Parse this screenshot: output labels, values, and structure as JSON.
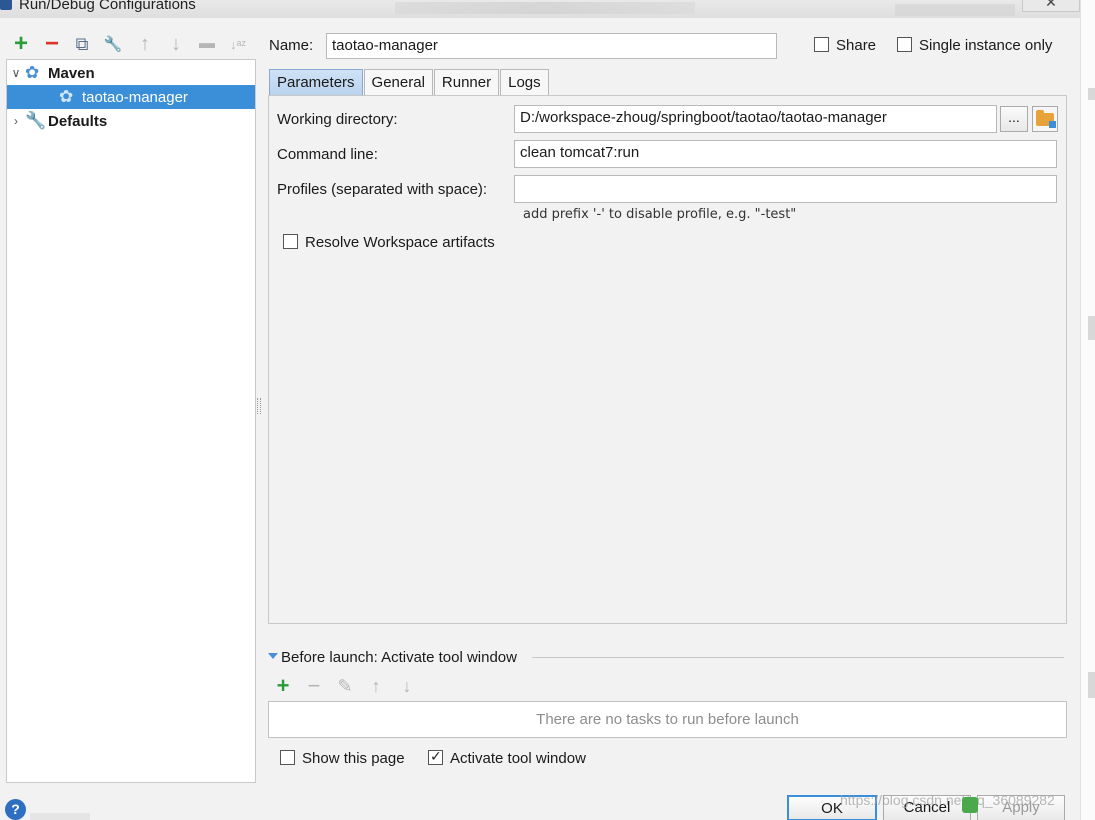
{
  "window": {
    "title": "Run/Debug Configurations",
    "close_glyph": "✕"
  },
  "left_toolbar": {
    "icons": [
      "add-icon",
      "remove-icon",
      "copy-icon",
      "wrench-icon",
      "arrow-up-icon",
      "arrow-down-icon",
      "folder-icon",
      "sort-icon"
    ],
    "glyphs": {
      "add": "+",
      "remove": "−",
      "copy": "⧉",
      "wrench": "🔧",
      "up": "↑",
      "down": "↓",
      "folder": "▬",
      "sort": "↓ᵃᶻ"
    }
  },
  "tree": {
    "maven_label": "Maven",
    "maven_child": "taotao-manager",
    "defaults_label": "Defaults",
    "expand_glyph": "∨",
    "collapse_glyph": "›",
    "gear_glyph": "✿"
  },
  "config": {
    "name_label": "Name:",
    "name_value": "taotao-manager",
    "share_label": "Share",
    "single_instance_label": "Single instance only"
  },
  "tabs": [
    {
      "label": "Parameters",
      "active": true
    },
    {
      "label": "General",
      "active": false
    },
    {
      "label": "Runner",
      "active": false
    },
    {
      "label": "Logs",
      "active": false
    }
  ],
  "parameters": {
    "working_dir_label": "Working directory:",
    "working_dir_value": "D:/workspace-zhoug/springboot/taotao/taotao-manager",
    "browse_label": "...",
    "command_line_label": "Command line:",
    "command_line_value": "clean tomcat7:run",
    "profiles_label": "Profiles (separated with space):",
    "profiles_value": "",
    "profiles_hint": "add prefix '-' to disable profile, e.g. \"-test\"",
    "resolve_label": "Resolve Workspace artifacts"
  },
  "before_launch": {
    "title": "Before launch: Activate tool window",
    "empty_text": "There are no tasks to run before launch",
    "toolbar_glyphs": {
      "add": "+",
      "remove": "−",
      "edit": "✎",
      "up": "↑",
      "down": "↓"
    },
    "show_page_label": "Show this page",
    "activate_label": "Activate tool window"
  },
  "buttons": {
    "ok": "OK",
    "cancel": "Cancel",
    "apply": "Apply",
    "help": "?"
  },
  "watermark": "https://blog.csdn.net/qq_36089282",
  "colors": {
    "selection": "#3b8fd9",
    "add_green": "#2a9d3a",
    "remove_red": "#d9342b",
    "folder_orange": "#e7a23a"
  }
}
